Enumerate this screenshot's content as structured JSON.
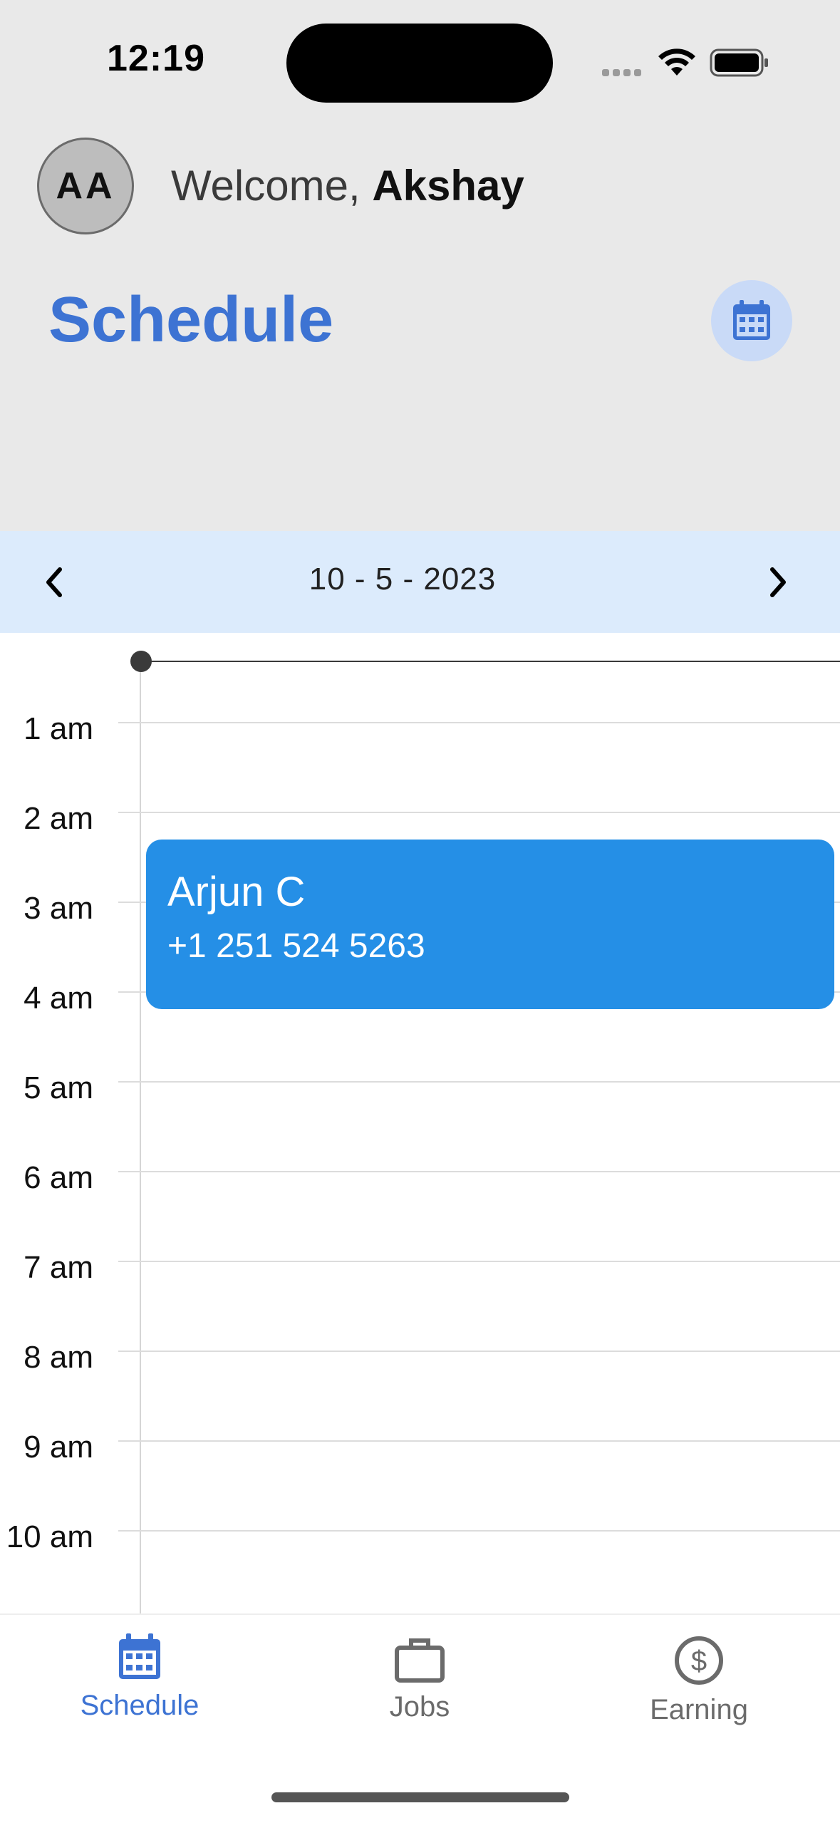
{
  "status_bar": {
    "time": "12:19"
  },
  "header": {
    "avatar_initials": "AA",
    "welcome_prefix": "Welcome,",
    "user_name": "Akshay",
    "title": "Schedule",
    "calendar_button_icon": "calendar-icon"
  },
  "date_nav": {
    "date": "10 - 5 - 2023",
    "prev_icon": "chevron-left-icon",
    "next_icon": "chevron-right-icon"
  },
  "timeline": {
    "hours": [
      "1 am",
      "2 am",
      "3 am",
      "4 am",
      "5 am",
      "6 am",
      "7 am",
      "8 am",
      "9 am",
      "10 am"
    ],
    "events": [
      {
        "name": "Arjun C",
        "phone": "+1 251 524 5263"
      }
    ]
  },
  "tabs": [
    {
      "label": "Schedule",
      "icon": "calendar-icon",
      "active": true
    },
    {
      "label": "Jobs",
      "icon": "briefcase-icon",
      "active": false
    },
    {
      "label": "Earning",
      "icon": "dollar-circle-icon",
      "active": false
    }
  ],
  "colors": {
    "accent": "#3d73d3",
    "event": "#258fe6",
    "header_bg": "#e9e9e9",
    "date_bar_bg": "#dcebfc",
    "inactive_tab": "#6b6b6b"
  }
}
